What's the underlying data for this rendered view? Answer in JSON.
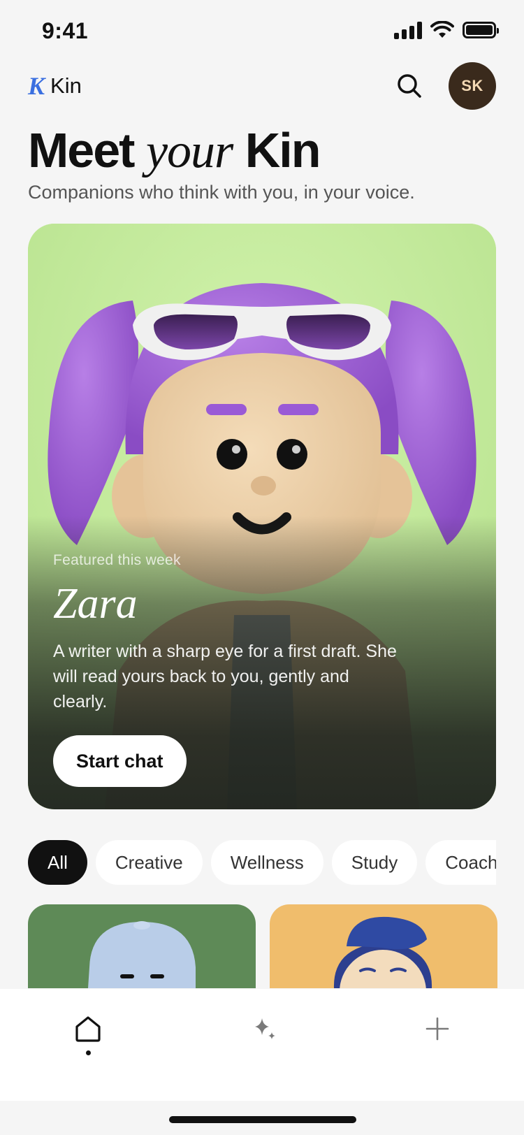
{
  "status_bar": {
    "time": "9:41"
  },
  "app_bar": {
    "logo_mark": "K",
    "app_name": "Kin",
    "avatar_initials": "SK"
  },
  "hero": {
    "title_part1": "Meet",
    "title_italic": "your",
    "title_part2": "Kin",
    "subtitle": "Companions who think with you, in your voice."
  },
  "featured": {
    "eyebrow": "Featured this week",
    "name": "Zara",
    "description": "A writer with a sharp eye for a first draft. She will read yours back to you, gently and clearly.",
    "cta_label": "Start chat"
  },
  "filters": [
    "All",
    "Creative",
    "Wellness",
    "Study",
    "Coach"
  ],
  "colors": {
    "background": "#f5f5f5",
    "featured_bg": "#c9ef9f",
    "accent_logo": "#3a6fe0",
    "avatar_bg": "#3a2a1c",
    "card_green": "#5e8a57",
    "card_orange": "#f0bd6c"
  },
  "nav": [
    {
      "icon": "home-icon",
      "active": true
    },
    {
      "icon": "sparkle-icon",
      "active": false
    },
    {
      "icon": "plus-icon",
      "active": false
    }
  ]
}
